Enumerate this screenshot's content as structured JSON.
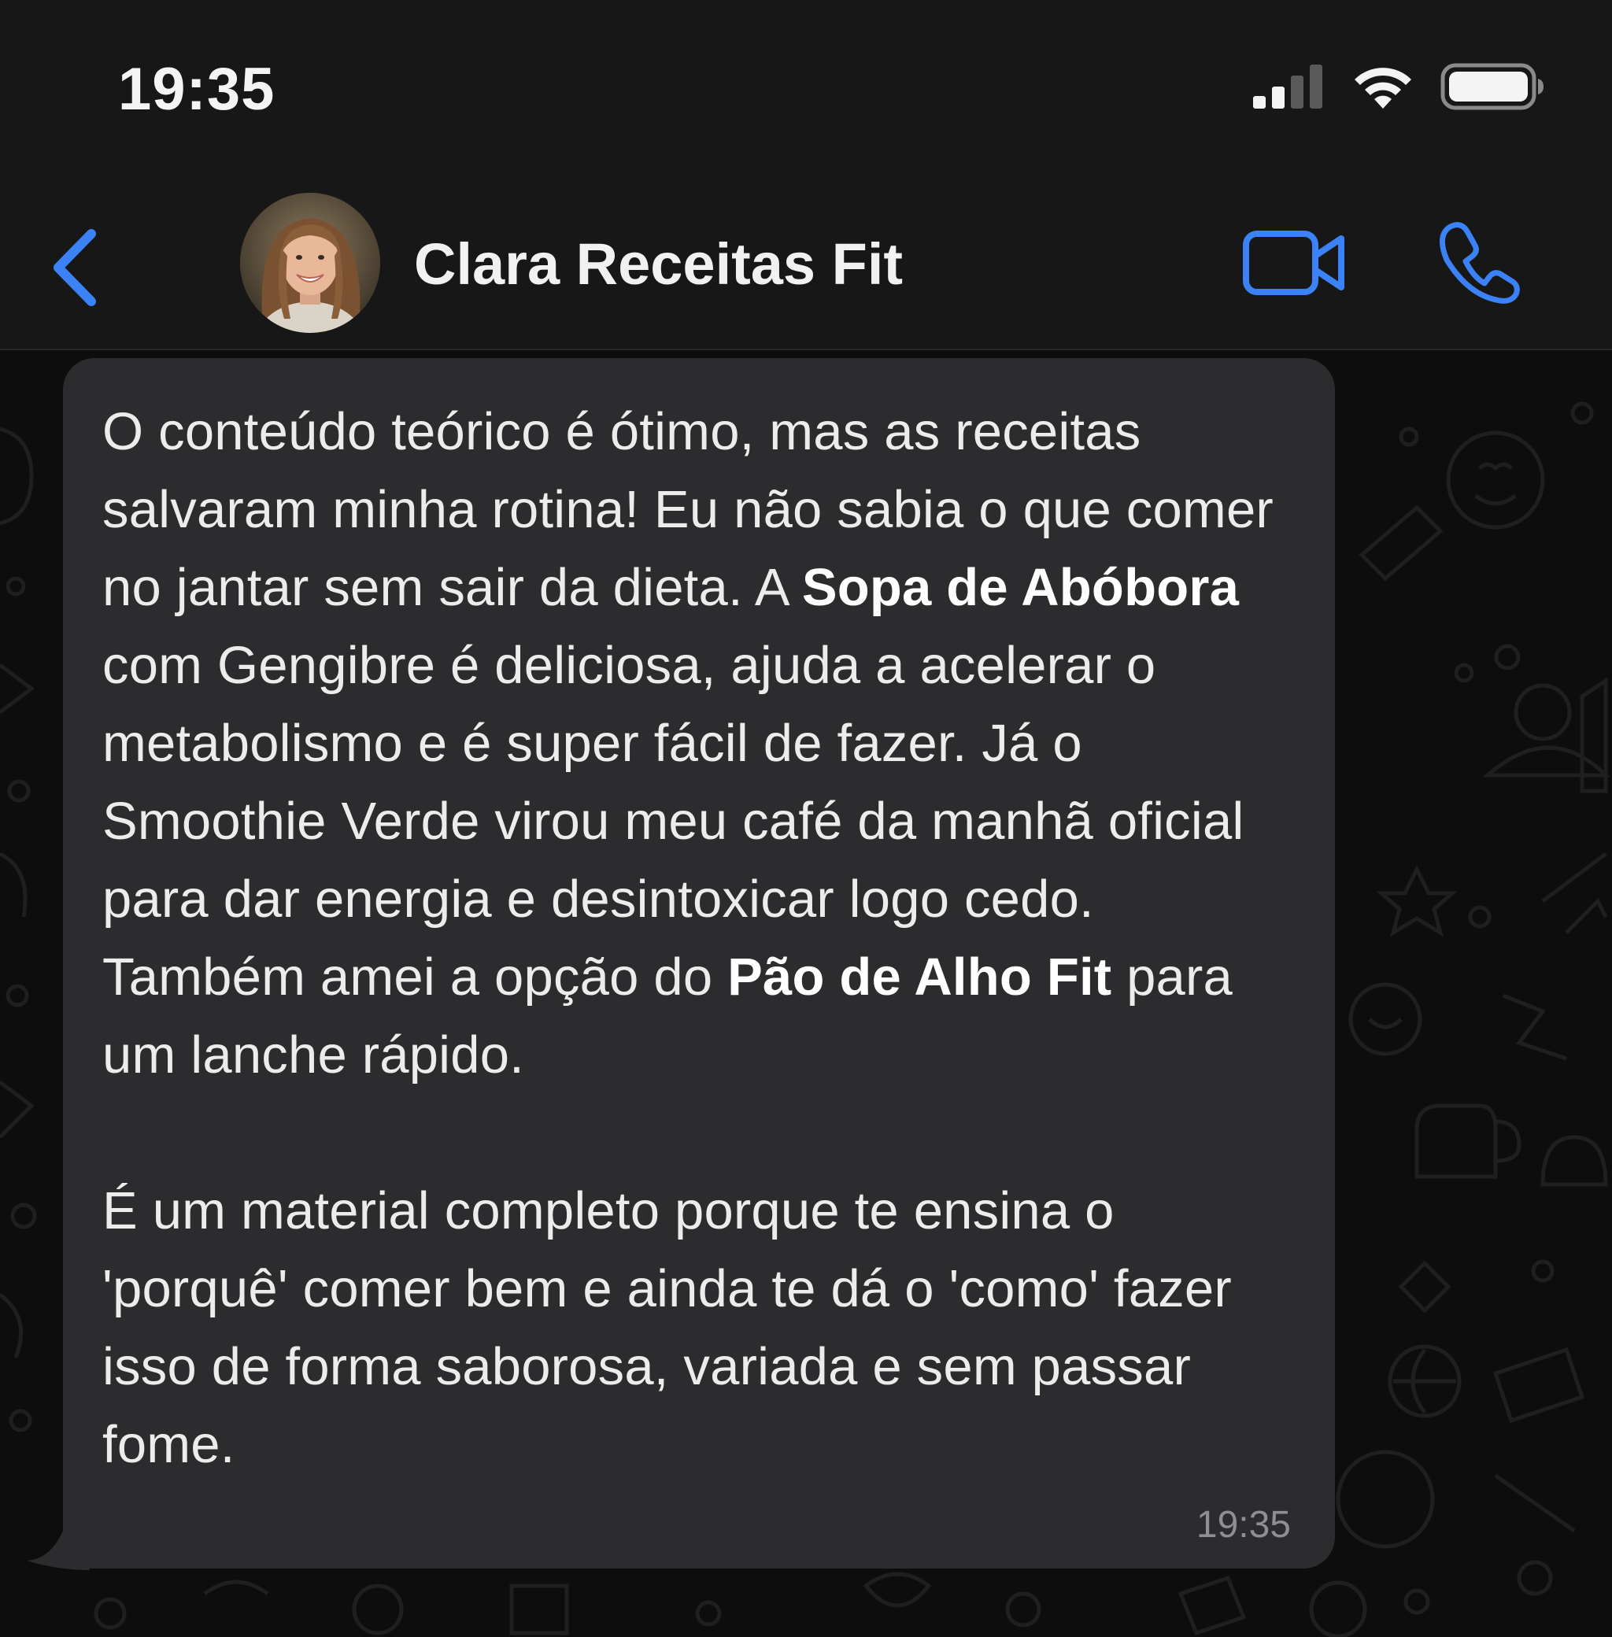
{
  "status_bar": {
    "time": "19:35",
    "icons": [
      "cellular-signal-icon",
      "wifi-icon",
      "battery-icon"
    ]
  },
  "header": {
    "contact_name": "Clara Receitas Fit",
    "back_icon": "chevron-left-icon",
    "video_icon": "video-camera-icon",
    "call_icon": "phone-icon",
    "accent_color": "#3b82f6"
  },
  "message": {
    "para1": {
      "part1": "O conteúdo teórico é ótimo, mas as receitas salvaram minha rotina! Eu não sabia o que comer no jantar sem sair da dieta. A ",
      "bold1": "Sopa de Abóbora",
      "part2": " com Gengibre é deliciosa, ajuda a acelerar o metabolismo e é super fácil de fazer. Já o Smoothie Verde virou meu café da manhã oficial para dar energia e desintoxicar logo cedo. Também amei a opção do ",
      "bold2": "Pão de Alho Fit",
      "part3": " para um lanche rápido."
    },
    "para2": "É um material completo porque te ensina o 'porquê' comer bem e ainda te dá o 'como' fazer isso de forma saborosa, variada e sem passar fome.",
    "time": "19:35",
    "bubble_color": "#2c2c2e"
  }
}
